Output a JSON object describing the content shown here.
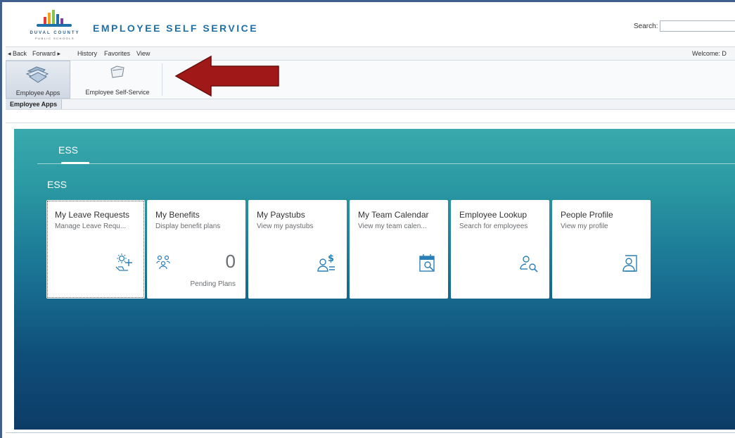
{
  "header": {
    "logo_line1": "DUVAL COUNTY",
    "logo_line2": "PUBLIC SCHOOLS",
    "title": "EMPLOYEE SELF SERVICE",
    "search_label": "Search:",
    "search_value": ""
  },
  "nav": {
    "back": "◂ Back",
    "forward": "Forward ▸",
    "history": "History",
    "favorites": "Favorites",
    "view": "View",
    "welcome": "Welcome: D"
  },
  "apps": {
    "items": [
      {
        "label": "Employee Apps",
        "icon": "employee-apps-icon"
      },
      {
        "label": "Employee Self-Service",
        "icon": "folder-icon"
      }
    ],
    "active_subtab": "Employee Apps"
  },
  "content": {
    "tab_label": "ESS",
    "section_title": "ESS",
    "tiles": [
      {
        "title": "My Leave Requests",
        "subtitle": "Manage Leave Requ...",
        "icon": "leave-icon"
      },
      {
        "title": "My Benefits",
        "subtitle": "Display benefit plans",
        "icon": "benefits-icon",
        "number": "0",
        "footer": "Pending Plans"
      },
      {
        "title": "My Paystubs",
        "subtitle": "View my paystubs",
        "icon": "paystub-icon"
      },
      {
        "title": "My Team Calendar",
        "subtitle": "View my team calen...",
        "icon": "calendar-icon"
      },
      {
        "title": "Employee Lookup",
        "subtitle": "Search for employees",
        "icon": "employee-search-icon"
      },
      {
        "title": "People Profile",
        "subtitle": "View my profile",
        "icon": "profile-icon"
      }
    ]
  },
  "colors": {
    "brand_blue": "#1f6fa8",
    "icon_blue": "#2b7fb8",
    "arrow_red": "#a01818"
  }
}
